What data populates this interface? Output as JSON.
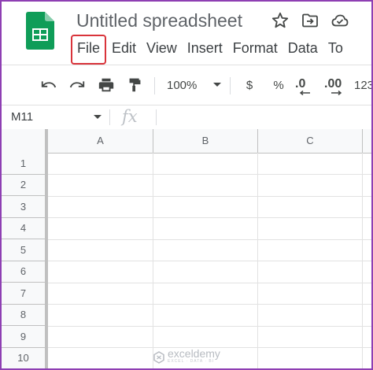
{
  "app": {
    "title": "Untitled spreadsheet",
    "logo_icon": "google-sheets-icon",
    "brand_color": "#0f9d58"
  },
  "title_icons": [
    "star-icon",
    "move-to-folder-icon",
    "cloud-status-icon"
  ],
  "menu": {
    "items": [
      {
        "label": "File",
        "highlighted": true
      },
      {
        "label": "Edit"
      },
      {
        "label": "View"
      },
      {
        "label": "Insert"
      },
      {
        "label": "Format"
      },
      {
        "label": "Data"
      },
      {
        "label": "To"
      }
    ],
    "highlight_color": "#d9343b"
  },
  "toolbar": {
    "zoom": "100%",
    "currency": "$",
    "percent": "%",
    "decrease_decimal": ".0",
    "increase_decimal": ".00",
    "more_formats": "123",
    "icons": [
      "undo-icon",
      "redo-icon",
      "print-icon",
      "paint-format-icon",
      "chevron-down-icon"
    ]
  },
  "formula_bar": {
    "name_box": "M11",
    "fx_label": "fx"
  },
  "grid": {
    "columns": [
      "A",
      "B",
      "C"
    ],
    "rows": [
      "1",
      "2",
      "3",
      "4",
      "5",
      "6",
      "7",
      "8",
      "9",
      "10"
    ]
  },
  "watermark": {
    "name": "exceldemy",
    "tagline": "EXCEL · DATA · BI"
  },
  "frame_color": "#8e3fb3"
}
